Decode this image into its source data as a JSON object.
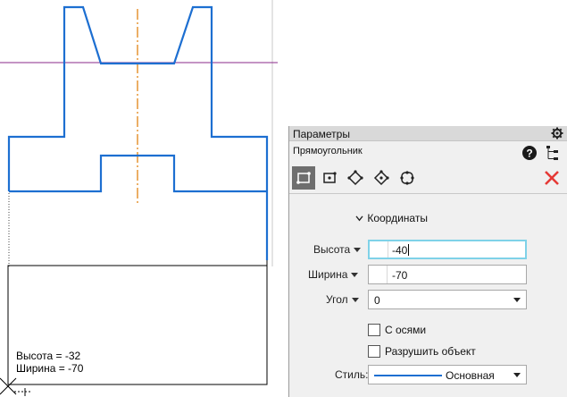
{
  "drawing": {
    "tooltip_height": "Высота = -32",
    "tooltip_width": "Ширина = -70"
  },
  "panel": {
    "title": "Параметры",
    "command": "Прямоугольник",
    "section": "Координаты",
    "fields": {
      "height_label": "Высота",
      "height_value": "-40",
      "width_label": "Ширина",
      "width_value": "-70",
      "angle_label": "Угол",
      "angle_value": "0"
    },
    "checkboxes": {
      "axes": "С осями",
      "destroy": "Разрушить объект"
    },
    "style": {
      "label": "Стиль:",
      "value": "Основная"
    }
  },
  "colors": {
    "contour": "#1d6fd1",
    "axis": "#e07a00",
    "guide": "#8a2a8a",
    "close": "#e53935",
    "focus": "#7fd2e8"
  }
}
